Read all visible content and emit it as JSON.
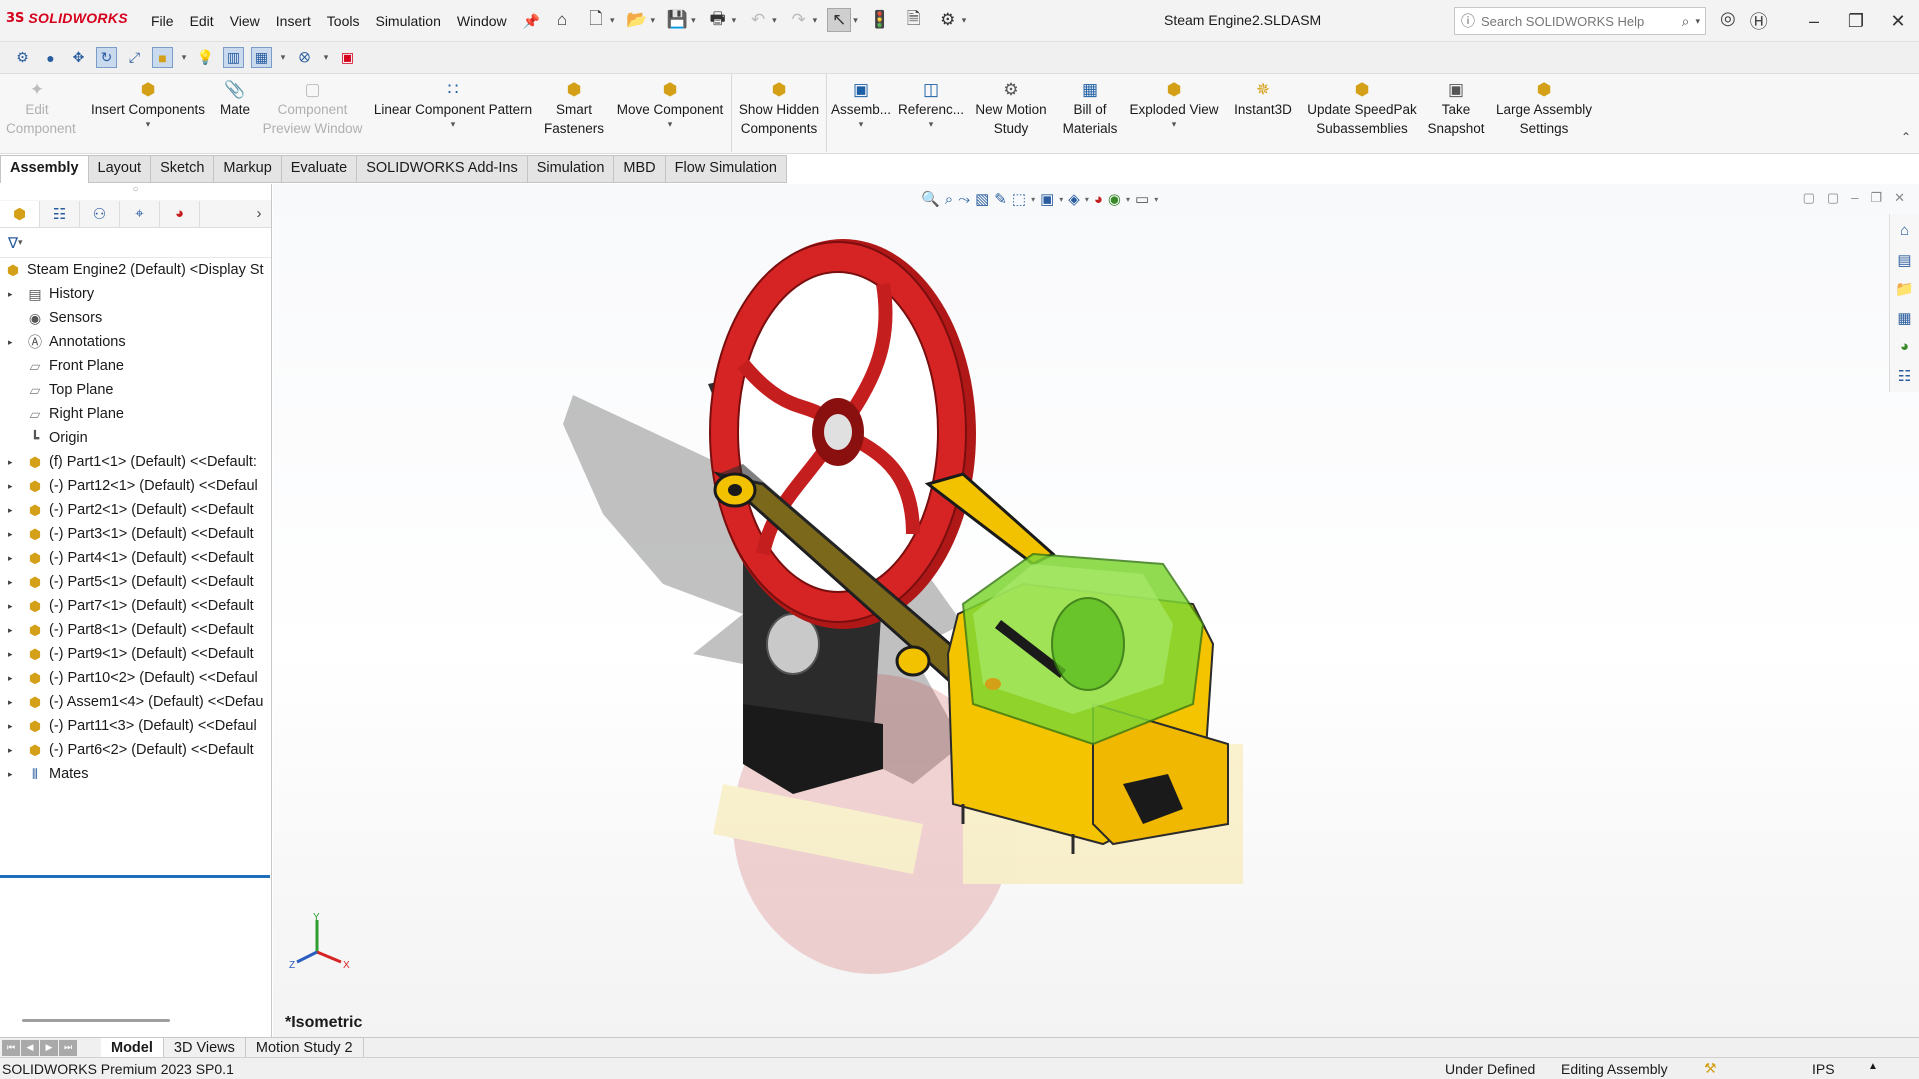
{
  "app": {
    "logo_prefix": "3S",
    "logo_text": "SOLIDWORKS",
    "document_title": "Steam Engine2.SLDASM"
  },
  "menu": [
    "File",
    "Edit",
    "View",
    "Insert",
    "Tools",
    "Simulation",
    "Window"
  ],
  "help_search": {
    "placeholder": "Search SOLIDWORKS Help"
  },
  "command_manager": {
    "edit_component": "Edit Component",
    "insert_components": "Insert Components",
    "mate": "Mate",
    "component_preview_window": "Component Preview Window",
    "linear_component_pattern": "Linear Component Pattern",
    "smart_fasteners": "Smart Fasteners",
    "move_component": "Move Component",
    "show_hidden_components": "Show Hidden Components",
    "assembly": "Assemb...",
    "reference": "Referenc...",
    "new_motion_study": "New Motion Study",
    "bill_of_materials": "Bill of Materials",
    "exploded_view": "Exploded View",
    "instant3d": "Instant3D",
    "update_speedpak": "Update SpeedPak Subassemblies",
    "take_snapshot": "Take Snapshot",
    "large_assembly_settings": "Large Assembly Settings"
  },
  "tabs": [
    "Assembly",
    "Layout",
    "Sketch",
    "Markup",
    "Evaluate",
    "SOLIDWORKS Add-Ins",
    "Simulation",
    "MBD",
    "Flow Simulation"
  ],
  "tree": {
    "root": "Steam Engine2 (Default) <Display St",
    "items": [
      {
        "label": "History",
        "icon": "history-icon",
        "expand": true
      },
      {
        "label": "Sensors",
        "icon": "sensors-icon",
        "expand": false
      },
      {
        "label": "Annotations",
        "icon": "annotations-icon",
        "expand": true
      },
      {
        "label": "Front Plane",
        "icon": "plane-icon",
        "expand": false
      },
      {
        "label": "Top Plane",
        "icon": "plane-icon",
        "expand": false
      },
      {
        "label": "Right Plane",
        "icon": "plane-icon",
        "expand": false
      },
      {
        "label": "Origin",
        "icon": "origin-icon",
        "expand": false
      },
      {
        "label": "(f) Part1<1> (Default) <<Default:",
        "icon": "part-icon",
        "expand": true
      },
      {
        "label": "(-) Part12<1> (Default) <<Defaul",
        "icon": "part-icon",
        "expand": true
      },
      {
        "label": "(-) Part2<1> (Default) <<Default",
        "icon": "part-icon",
        "expand": true
      },
      {
        "label": "(-) Part3<1> (Default) <<Default",
        "icon": "part-icon",
        "expand": true
      },
      {
        "label": "(-) Part4<1> (Default) <<Default",
        "icon": "part-icon",
        "expand": true
      },
      {
        "label": "(-) Part5<1> (Default) <<Default",
        "icon": "part-icon",
        "expand": true
      },
      {
        "label": "(-) Part7<1> (Default) <<Default",
        "icon": "part-icon",
        "expand": true
      },
      {
        "label": "(-) Part8<1> (Default) <<Default",
        "icon": "part-icon",
        "expand": true
      },
      {
        "label": "(-) Part9<1> (Default) <<Default",
        "icon": "part-icon",
        "expand": true
      },
      {
        "label": "(-) Part10<2> (Default) <<Defaul",
        "icon": "part-icon",
        "expand": true
      },
      {
        "label": "(-) Assem1<4> (Default) <<Defau",
        "icon": "assembly-icon",
        "expand": true
      },
      {
        "label": "(-) Part11<3> (Default) <<Defaul",
        "icon": "part-icon",
        "expand": true
      },
      {
        "label": "(-) Part6<2> (Default) <<Default",
        "icon": "part-icon",
        "expand": true
      },
      {
        "label": "Mates",
        "icon": "mates-icon",
        "expand": true
      }
    ]
  },
  "viewport": {
    "view_label": "*Isometric",
    "triad": {
      "x": "X",
      "y": "Y",
      "z": "Z"
    }
  },
  "bottom_tabs": [
    "Model",
    "3D Views",
    "Motion Study 2"
  ],
  "status": {
    "version": "SOLIDWORKS Premium 2023 SP0.1",
    "definition": "Under Defined",
    "mode": "Editing Assembly",
    "units": "IPS"
  },
  "colors": {
    "flywheel": "#c41e1e",
    "link": "#f2c200",
    "cylinder_glass": "#7fd633",
    "frame": "#2b2b2b",
    "brand": "#d6001c"
  }
}
